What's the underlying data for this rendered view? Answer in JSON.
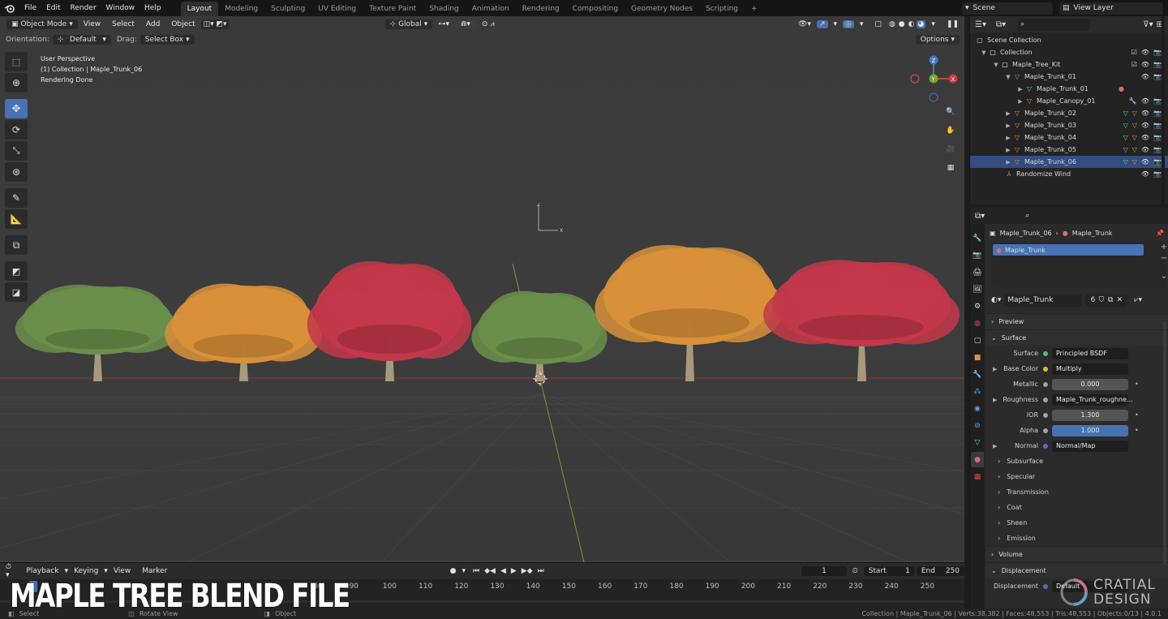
{
  "topbar": {
    "menus": [
      "File",
      "Edit",
      "Render",
      "Window",
      "Help"
    ],
    "workspaces": [
      "Layout",
      "Modeling",
      "Sculpting",
      "UV Editing",
      "Texture Paint",
      "Shading",
      "Animation",
      "Rendering",
      "Compositing",
      "Geometry Nodes",
      "Scripting"
    ],
    "active_workspace": "Layout",
    "add_tab": "+",
    "scene_name": "Scene",
    "view_layer": "View Layer"
  },
  "viewport": {
    "mode": "Object Mode",
    "menus": [
      "View",
      "Select",
      "Add",
      "Object"
    ],
    "transform": "Global",
    "options": "Options",
    "orientation_label": "Orientation:",
    "orientation_value": "Default",
    "drag_label": "Drag:",
    "drag_value": "Select Box",
    "overlay": {
      "line1": "User Perspective",
      "line2": "(1) Collection | Maple_Trunk_06",
      "line3": "Rendering Done"
    },
    "gizmo": {
      "z": "Z",
      "x": "X",
      "y": "Y"
    },
    "trees": [
      {
        "color": "green"
      },
      {
        "color": "orange"
      },
      {
        "color": "red"
      },
      {
        "color": "green"
      },
      {
        "color": "orange"
      },
      {
        "color": "red"
      }
    ],
    "colors": {
      "green": "#6a8f4a",
      "orange": "#d9913a",
      "red": "#c3384a"
    }
  },
  "outliner": {
    "root": "Scene Collection",
    "items": [
      {
        "label": "Collection",
        "depth": 0,
        "icon": "collection-icon"
      },
      {
        "label": "Maple_Tree_Kit",
        "depth": 1,
        "icon": "collection-icon"
      },
      {
        "label": "Maple_Trunk_01",
        "depth": 2,
        "icon": "mesh-object-icon"
      },
      {
        "label": "Maple_Trunk_01",
        "depth": 3,
        "icon": "mesh-data-icon"
      },
      {
        "label": "Maple_Canopy_01",
        "depth": 3,
        "icon": "mesh-object-icon"
      },
      {
        "label": "Maple_Trunk_02",
        "depth": 2,
        "icon": "mesh-object-icon"
      },
      {
        "label": "Maple_Trunk_03",
        "depth": 2,
        "icon": "mesh-object-icon"
      },
      {
        "label": "Maple_Trunk_04",
        "depth": 2,
        "icon": "mesh-object-icon"
      },
      {
        "label": "Maple_Trunk_05",
        "depth": 2,
        "icon": "mesh-object-icon"
      },
      {
        "label": "Maple_Trunk_06",
        "depth": 2,
        "icon": "mesh-object-icon"
      },
      {
        "label": "Randomize Wind",
        "depth": 1,
        "icon": "armature-icon"
      }
    ]
  },
  "properties": {
    "breadcrumb_object": "Maple_Trunk_06",
    "breadcrumb_material": "Maple_Trunk",
    "slot_name": "Maple_Trunk",
    "material_name": "Maple_Trunk",
    "user_count": "6",
    "panels": {
      "preview": "Preview",
      "surface": "Surface",
      "volume": "Volume",
      "displacement": "Displacement"
    },
    "surface_rows": [
      {
        "label": "Surface",
        "value": "Principled BSDF",
        "socket": "#4ec36f",
        "style": "dark"
      },
      {
        "label": "Base Color",
        "value": "Multiply",
        "socket": "#c7c729",
        "style": "dark"
      },
      {
        "label": "Metallic",
        "value": "0.000",
        "socket": "#a1a1a1",
        "style": "num"
      },
      {
        "label": "Roughness",
        "value": "Maple_Trunk_roughne...",
        "socket": "#a1a1a1",
        "style": "dark"
      },
      {
        "label": "IOR",
        "value": "1.300",
        "socket": "#a1a1a1",
        "style": "num"
      },
      {
        "label": "Alpha",
        "value": "1.000",
        "socket": "#a1a1a1",
        "style": "blue"
      },
      {
        "label": "Normal",
        "value": "Normal/Map",
        "socket": "#6363c7",
        "style": "dark"
      }
    ],
    "subpanels": [
      "Subsurface",
      "Specular",
      "Transmission",
      "Coat",
      "Sheen",
      "Emission"
    ],
    "displacement_label": "Displacement",
    "displacement_value": "Default"
  },
  "timeline": {
    "menus": [
      "Playback",
      "Keying",
      "View",
      "Marker"
    ],
    "current_frame": "1",
    "start_label": "Start",
    "start": "1",
    "end_label": "End",
    "end": "250",
    "ticks": [
      "80",
      "90",
      "100",
      "110",
      "120",
      "130",
      "140",
      "150",
      "160",
      "170",
      "180",
      "190",
      "200",
      "210",
      "220",
      "230",
      "240",
      "250"
    ]
  },
  "statusbar": {
    "left1": "Select",
    "left2": "Rotate View",
    "left3": "Object",
    "right": "Collection | Maple_Trunk_06 | Verts:38,382 | Faces:48,553 | Tris:48,553 | Objects:0/13 | 4.0.1"
  },
  "banner": "MAPLE TREE BLEND FILE",
  "watermark": {
    "line1": "CRATIAL",
    "line2": "DESIGN"
  }
}
